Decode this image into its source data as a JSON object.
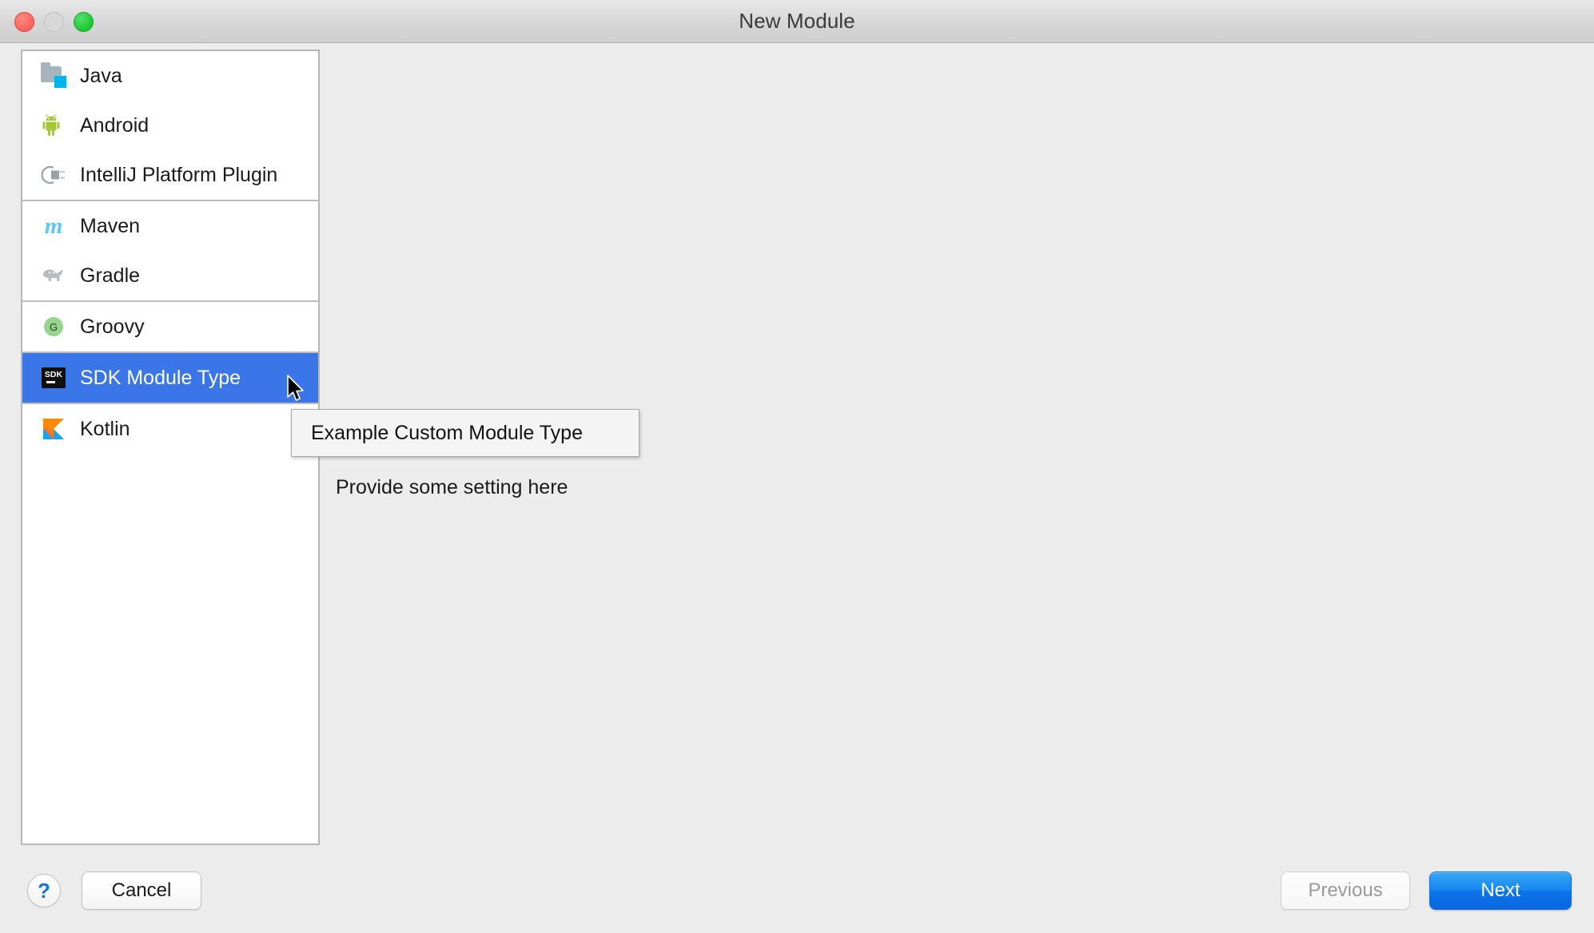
{
  "window": {
    "title": "New Module",
    "traffic_lights": [
      "close",
      "minimize",
      "maximize"
    ]
  },
  "module_list": {
    "groups": [
      {
        "items": [
          {
            "label": "Java",
            "icon": "java-folder-icon",
            "selected": false
          },
          {
            "label": "Android",
            "icon": "android-robot-icon",
            "selected": false
          },
          {
            "label": "IntelliJ Platform Plugin",
            "icon": "plug-icon",
            "selected": false
          }
        ]
      },
      {
        "items": [
          {
            "label": "Maven",
            "icon": "maven-m-icon",
            "selected": false
          },
          {
            "label": "Gradle",
            "icon": "gradle-elephant-icon",
            "selected": false
          }
        ]
      },
      {
        "items": [
          {
            "label": "Groovy",
            "icon": "groovy-g-icon",
            "selected": false
          }
        ]
      },
      {
        "items": [
          {
            "label": "SDK Module Type",
            "icon": "sdk-badge-icon",
            "selected": true
          }
        ]
      },
      {
        "items": [
          {
            "label": "Kotlin",
            "icon": "kotlin-k-icon",
            "selected": false
          }
        ]
      }
    ]
  },
  "tooltip": {
    "text": "Example Custom Module Type"
  },
  "main_pane": {
    "setting_text": "Provide some setting here"
  },
  "footer": {
    "help_label": "?",
    "cancel_label": "Cancel",
    "previous_label": "Previous",
    "next_label": "Next"
  },
  "colors": {
    "selection_blue": "#3b76e8",
    "default_button_blue": "#0c73ea",
    "window_background": "#ececec",
    "list_background": "#ffffff",
    "help_blue": "#1273e6",
    "disabled_text": "#9a9a9a"
  }
}
